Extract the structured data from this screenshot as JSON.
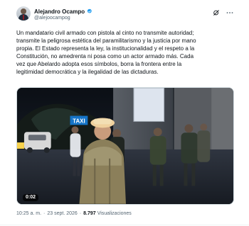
{
  "tweet": {
    "author": {
      "display_name": "Alejandro Ocampo",
      "handle": "@alejoocampog",
      "verified": true
    },
    "text": "Un mandatario civil armado con pistola al cinto no transmite autoridad;\ntransmite la peligrosa estética del paramilitarismo y la justicia por mano\npropia. El Estado representa la ley, la institucionalidad y el respeto a la\nConstitución, no amedrenta ni posa como un actor armado más. Cada\nvez que Abelardo adopta esos símbolos, borra la frontera entre la\nlegitimidad democrática y la ilegalidad de las dictaduras.",
    "media": {
      "type": "video",
      "duration": "0:02",
      "scene_sign_text": "TAXI"
    },
    "meta": {
      "time": "10:25 a. m.",
      "separator": "·",
      "date": "23 sept. 2026",
      "views_count": "8.797",
      "views_label": "Visualizaciones"
    }
  },
  "icons": {
    "verified": "verified-badge-icon",
    "grok": "grok-icon",
    "more": "more-icon"
  },
  "colors": {
    "text": "#0f1419",
    "secondary": "#536471",
    "verified": "#1d9bf0",
    "border": "#cfd9de"
  }
}
